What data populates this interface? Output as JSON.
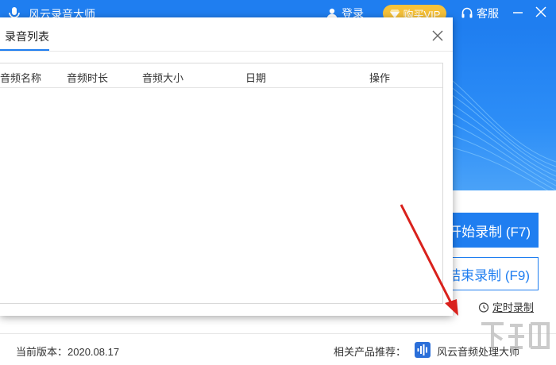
{
  "app": {
    "title": "风云录音大师",
    "login_label": "登录",
    "vip_label": "购买VIP",
    "service_label": "客服"
  },
  "main": {
    "start_label": "开始录制 (F7)",
    "stop_label": "结束录制 (F9)",
    "timer_label": "定时录制"
  },
  "status": {
    "version_label": "当前版本：2020.08.17",
    "recommend_label": "相关产品推荐：",
    "recommend_product": "风云音频处理大师"
  },
  "dialog": {
    "title": "录音列表",
    "columns": [
      "音频名称",
      "音频时长",
      "音频大小",
      "日期",
      "操作"
    ]
  },
  "colors": {
    "brand": "#1f7ef0",
    "vip": "#f6c23a",
    "annotation_arrow": "#d9211c"
  }
}
